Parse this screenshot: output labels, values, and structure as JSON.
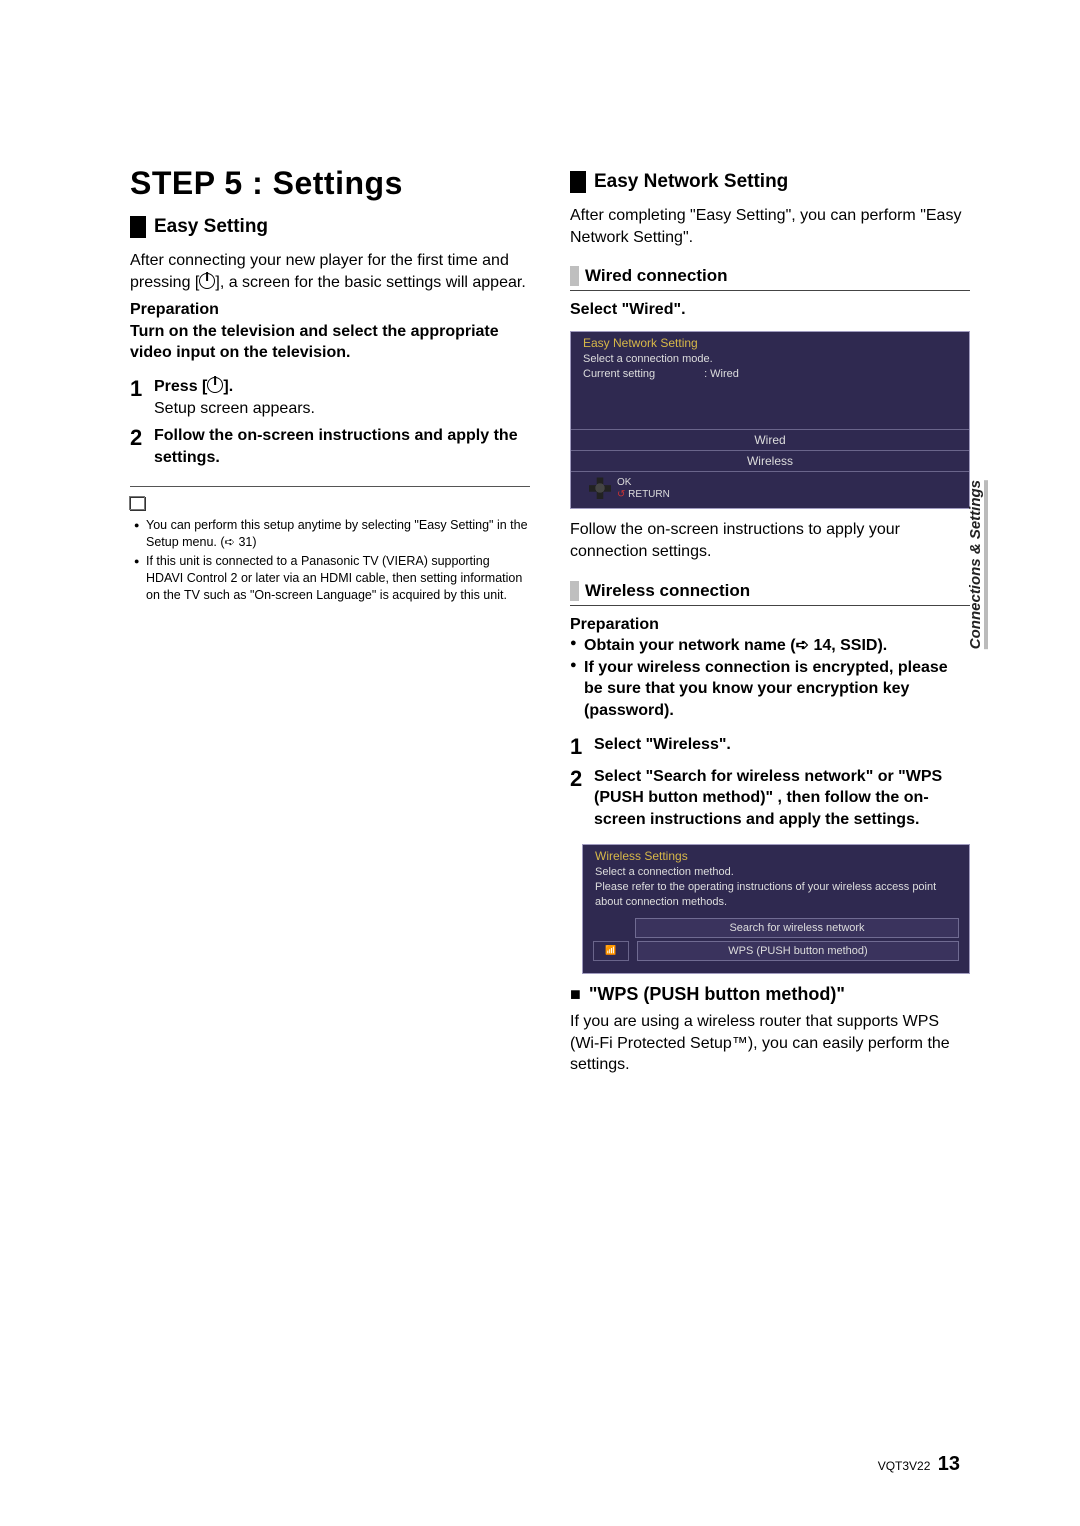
{
  "title": "STEP 5 : Settings",
  "easy_setting": {
    "heading": "Easy Setting",
    "intro_a": "After connecting your new player for the first time and pressing [",
    "intro_b": "], a screen for the basic settings will appear.",
    "prep_label": "Preparation",
    "prep_text": "Turn on the television and select the appropriate video input on the television.",
    "step1_a": "Press [",
    "step1_b": "].",
    "step1_sub": "Setup screen appears.",
    "step2": "Follow the on-screen instructions and apply the settings.",
    "notes": [
      "You can perform this setup anytime by selecting \"Easy Setting\" in the Setup menu. (➪ 31)",
      "If this unit is connected to a Panasonic TV (VIERA) supporting HDAVI Control 2 or later via an HDMI cable, then setting information on the TV such as \"On-screen Language\" is acquired by this unit."
    ]
  },
  "network": {
    "heading": "Easy Network Setting",
    "intro": "After completing \"Easy Setting\", you can perform \"Easy Network Setting\".",
    "wired": {
      "heading": "Wired connection",
      "select": "Select \"Wired\".",
      "screen_title": "Easy Network Setting",
      "screen_line1": "Select a connection mode.",
      "screen_line2a": "Current setting",
      "screen_line2b": ":  Wired",
      "opt1": "Wired",
      "opt2": "Wireless",
      "ok": "OK",
      "ret": "RETURN",
      "follow": "Follow the on-screen instructions to apply your connection settings."
    },
    "wireless": {
      "heading": "Wireless connection",
      "prep_label": "Preparation",
      "prep1": "Obtain your network name (➪ 14, SSID).",
      "prep2": "If your wireless connection is encrypted, please be sure that you know your encryption key (password).",
      "step1": "Select \"Wireless\".",
      "step2": "Select \"Search for wireless network\" or \"WPS (PUSH button method)\" , then follow the on-screen instructions and apply the settings.",
      "screen_title": "Wireless Settings",
      "screen_msg": "Select a connection method.\nPlease refer to the operating instructions of your wireless access point about connection methods.",
      "opt1": "Search for wireless network",
      "opt2": "WPS (PUSH button method)"
    },
    "wps": {
      "heading": "\"WPS (PUSH button method)\"",
      "body": "If you are using a wireless router that supports WPS (Wi-Fi Protected Setup™), you can easily perform the settings."
    }
  },
  "side_tab": "Connections & Settings",
  "footer_code": "VQT3V22",
  "footer_page": "13"
}
